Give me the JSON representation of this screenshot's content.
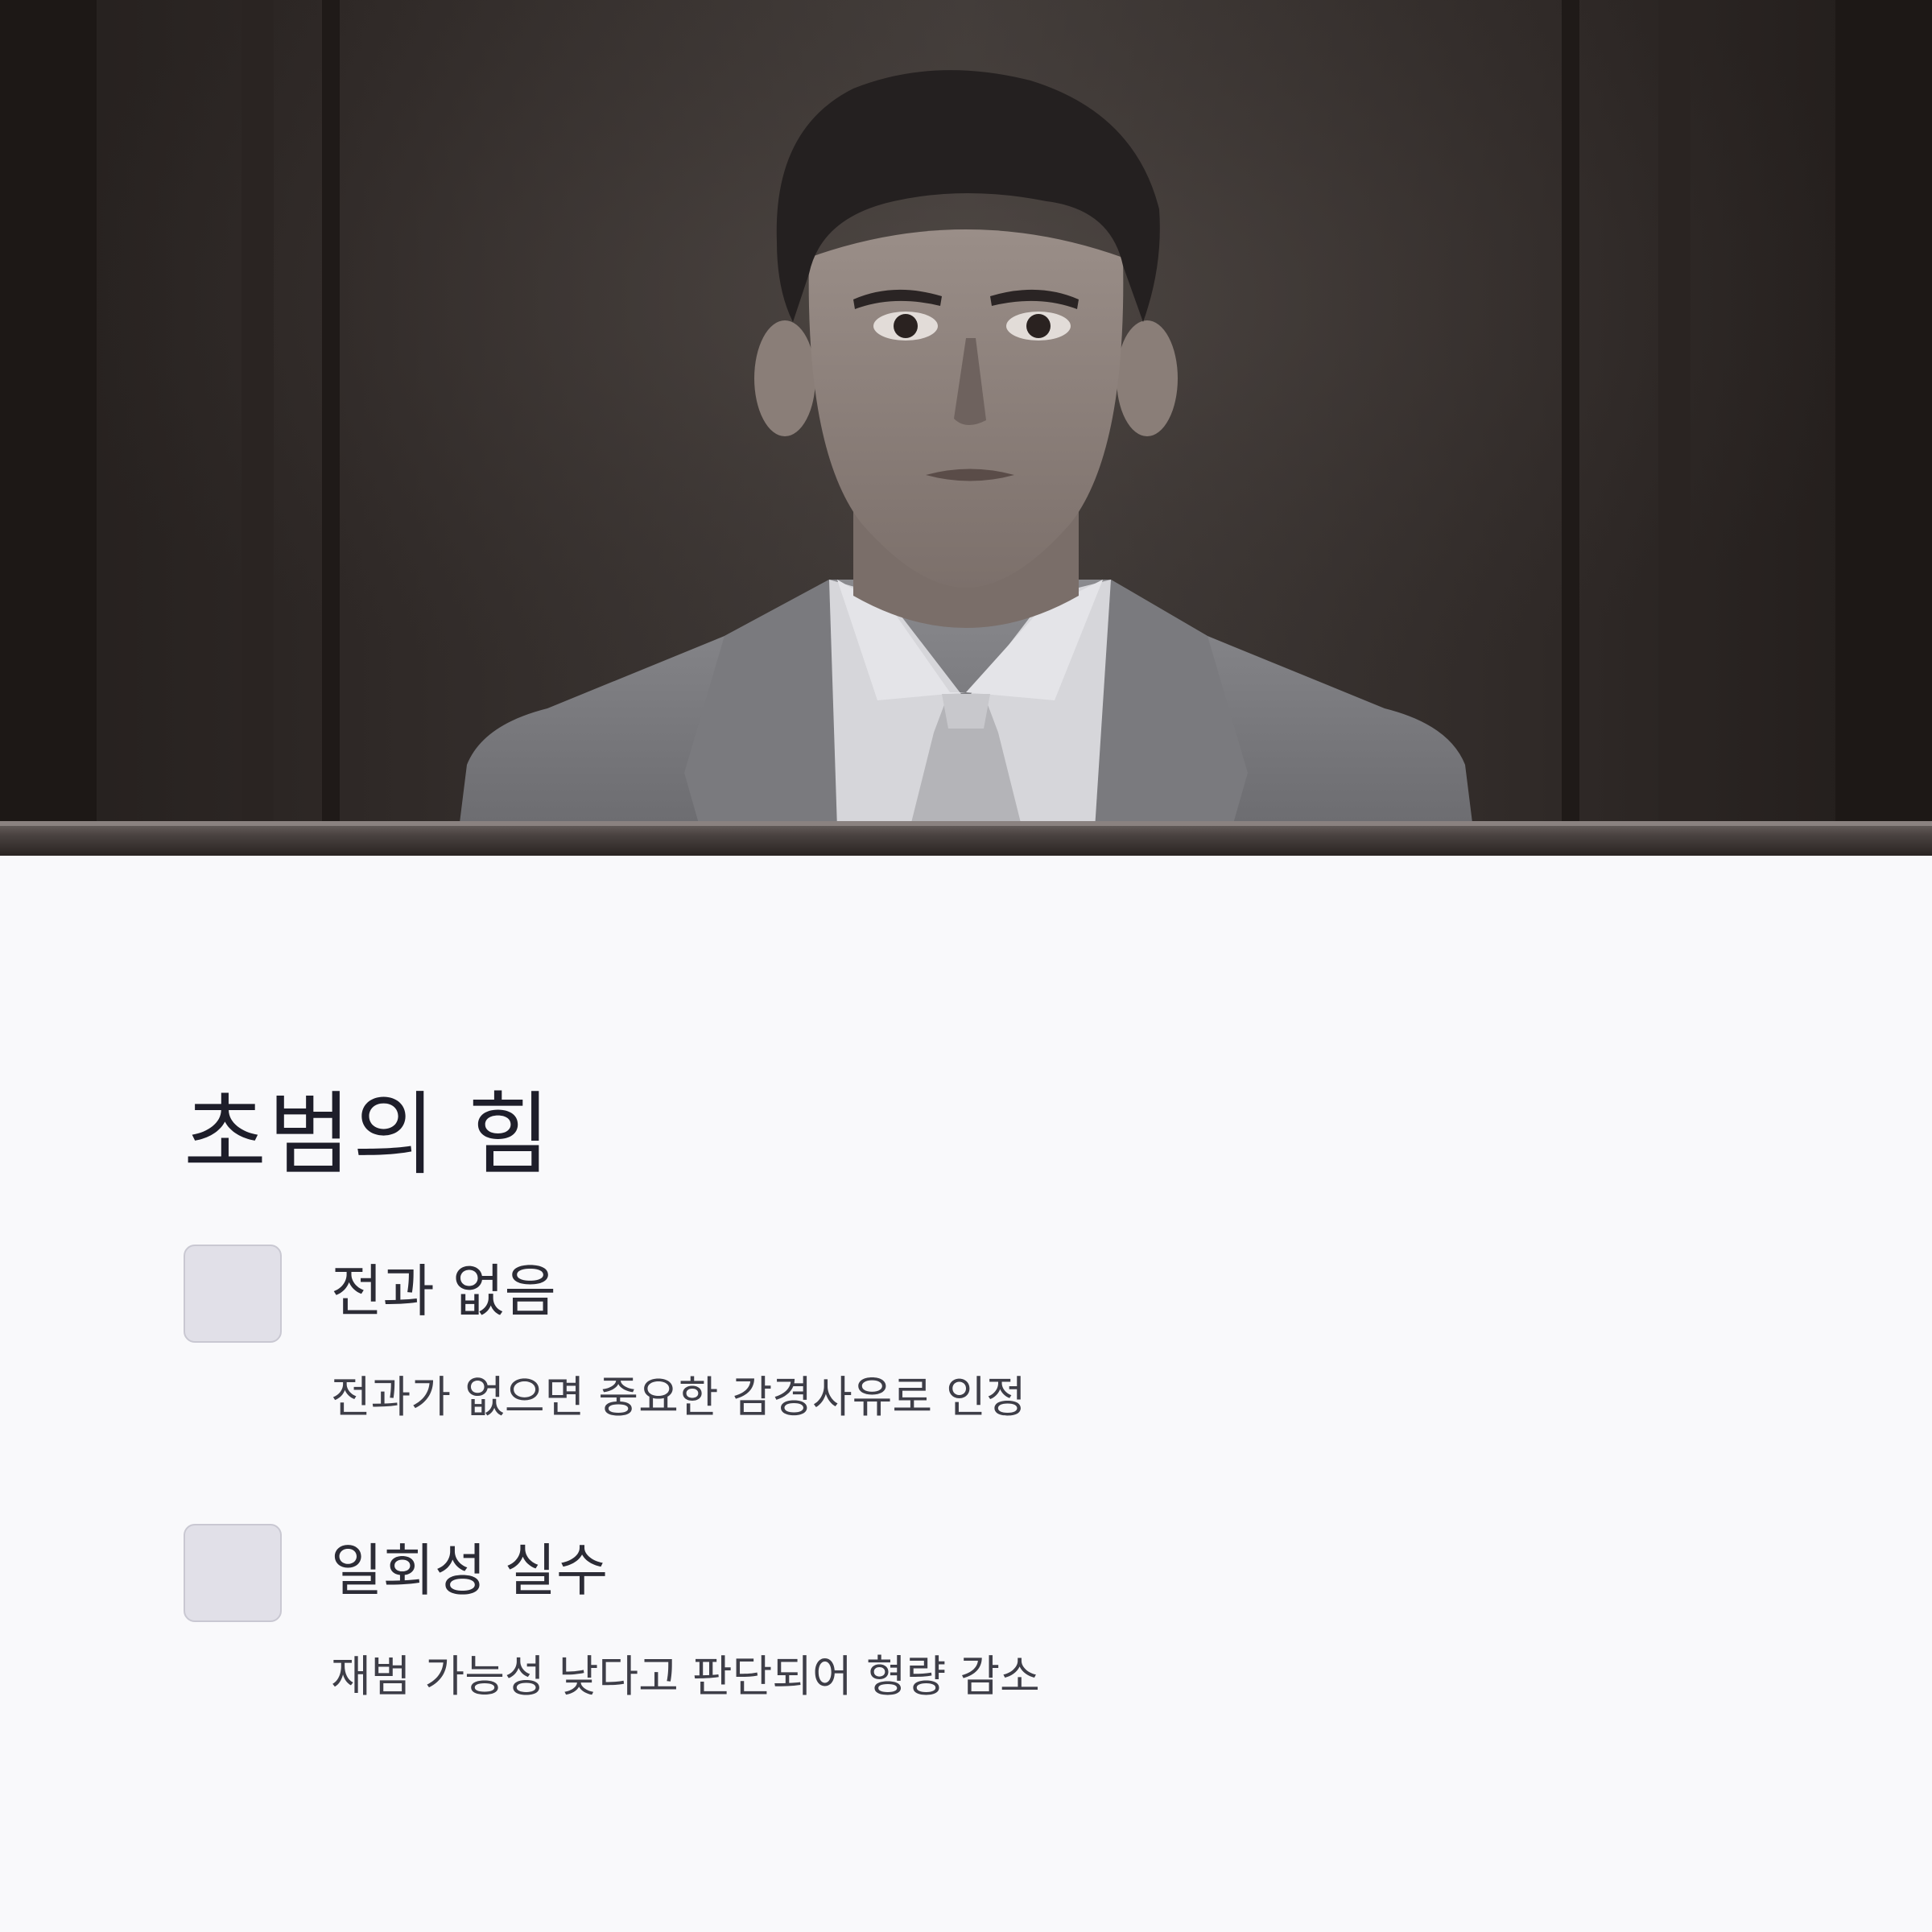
{
  "photo": {
    "subject": "man in grey suit and tie behind a wooden bench in a dark courtroom"
  },
  "title": "초범의 힘",
  "items": [
    {
      "heading": "전과 없음",
      "description": "전과가 없으면 중요한 감경사유로 인정"
    },
    {
      "heading": "일회성 실수",
      "description": "재범 가능성 낮다고 판단되어 형량 감소"
    }
  ],
  "colors": {
    "background": "#f9f9fb",
    "title": "#1e1e2a",
    "checkbox_fill": "#e1e0e8",
    "checkbox_border": "#c9c8d2"
  }
}
